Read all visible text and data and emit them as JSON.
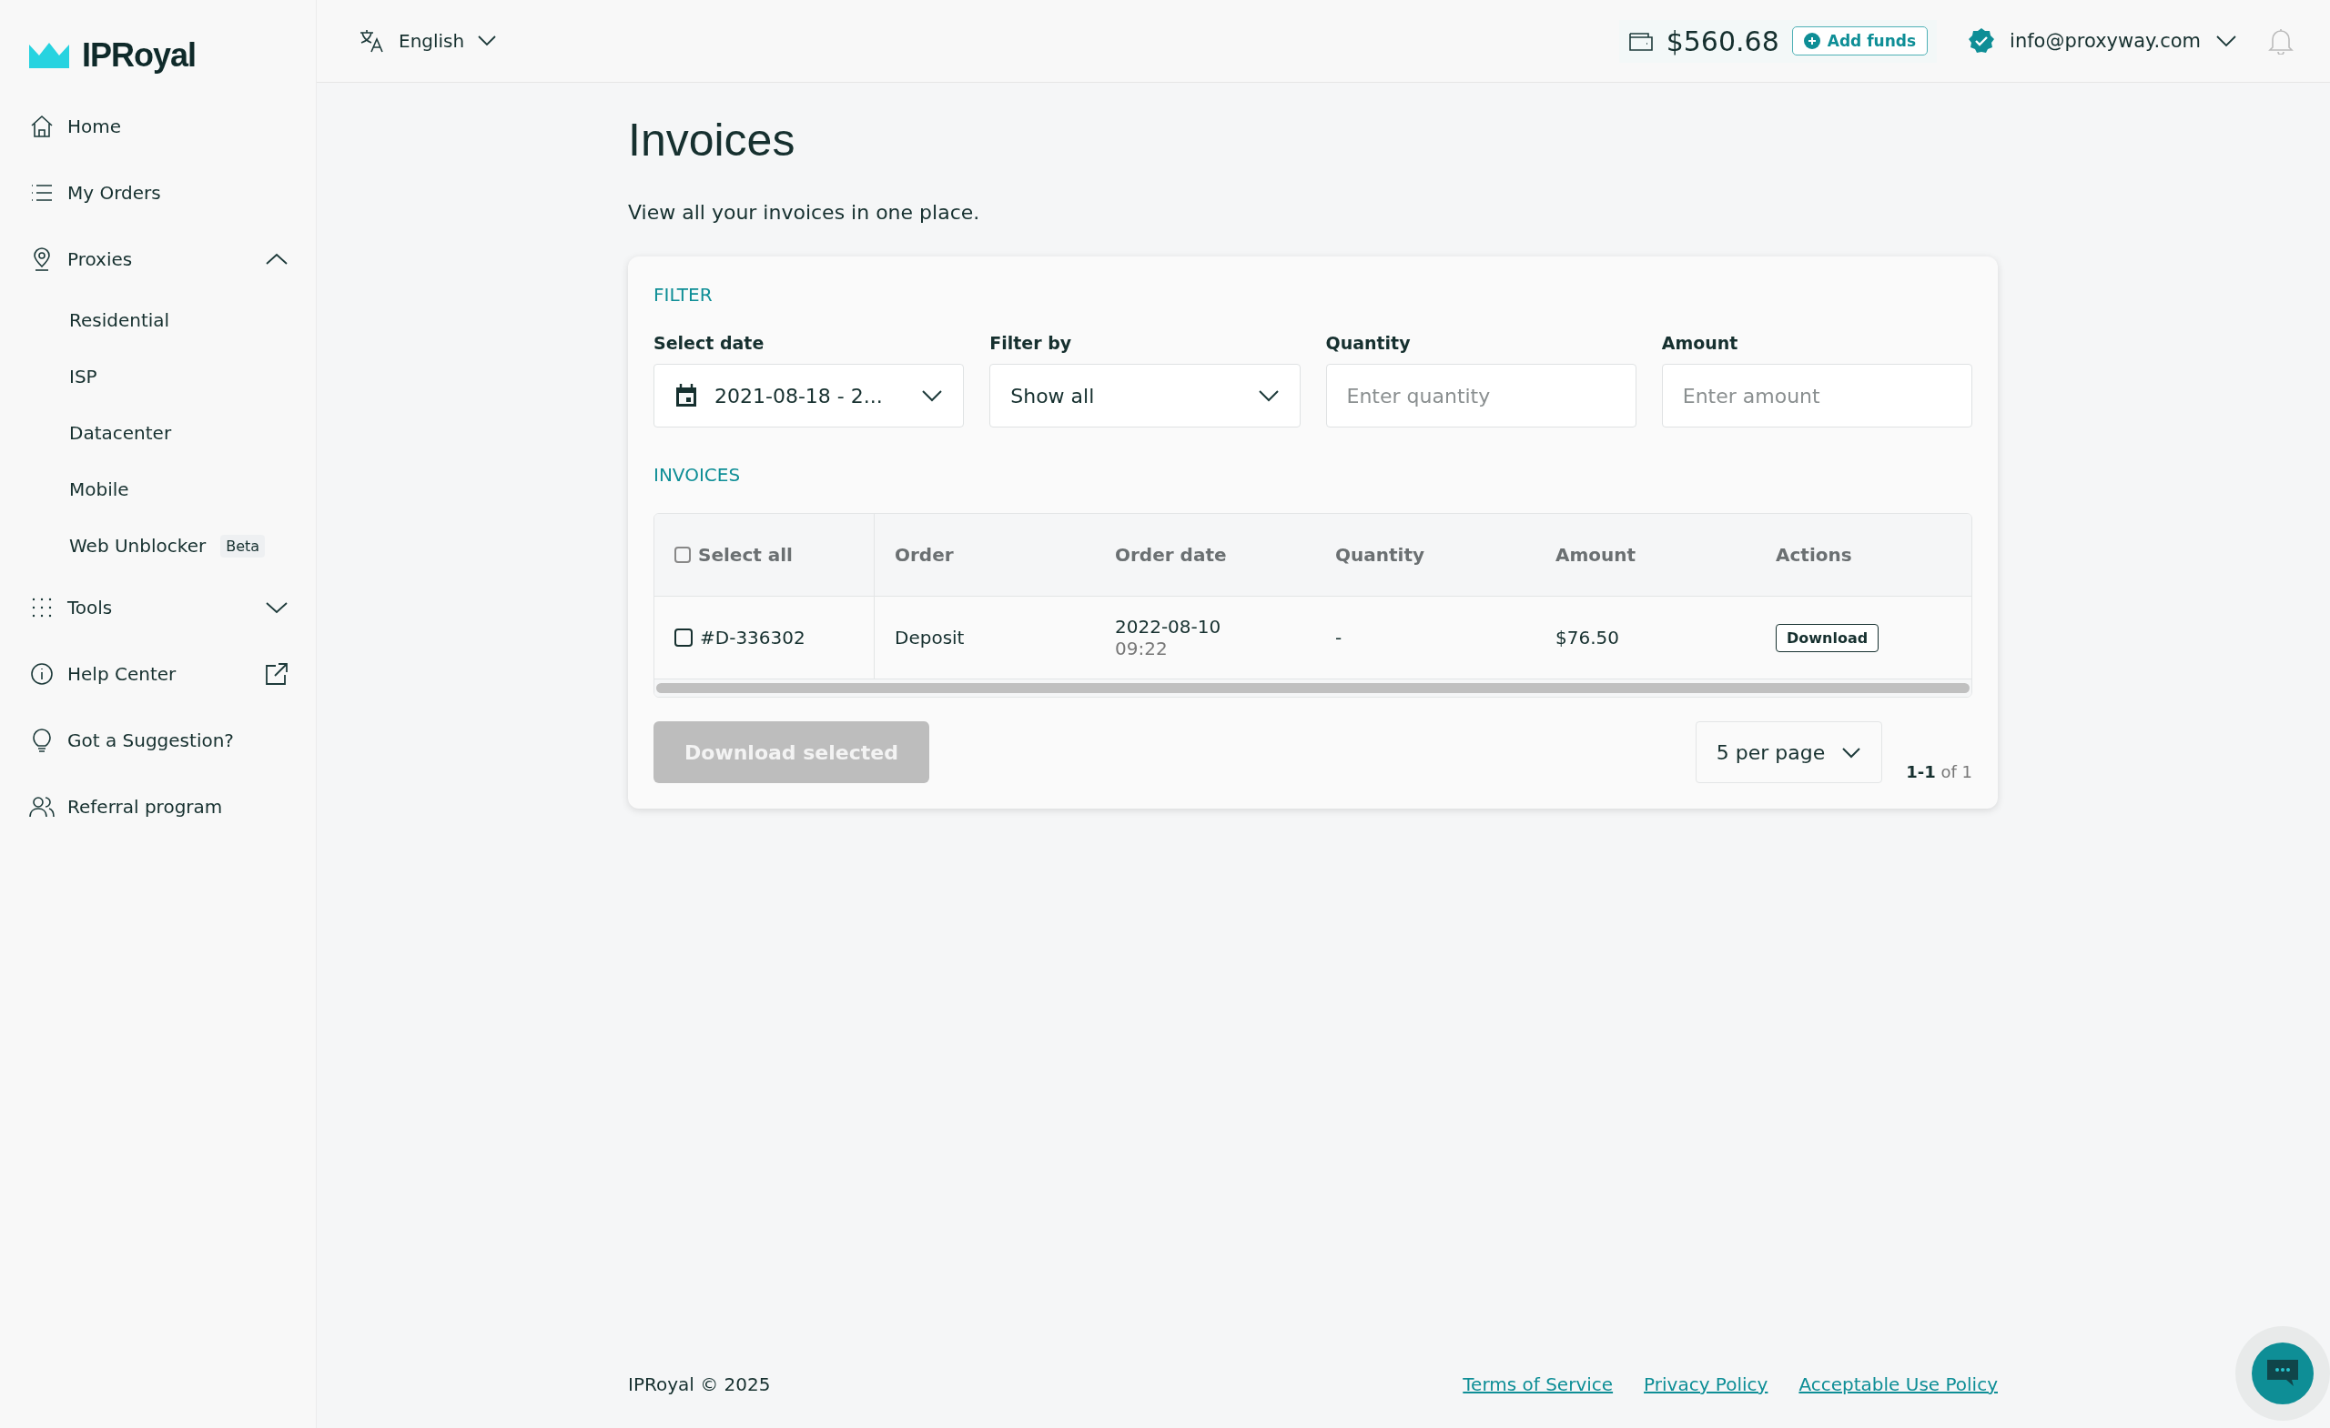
{
  "sidebar": {
    "logo": "IPRoyal",
    "items": [
      {
        "label": "Home"
      },
      {
        "label": "My Orders"
      },
      {
        "label": "Proxies",
        "expanded": true,
        "children": [
          {
            "label": "Residential"
          },
          {
            "label": "ISP"
          },
          {
            "label": "Datacenter"
          },
          {
            "label": "Mobile"
          },
          {
            "label": "Web Unblocker",
            "badge": "Beta"
          }
        ]
      },
      {
        "label": "Tools",
        "expanded": false
      },
      {
        "label": "Help Center",
        "external": true
      },
      {
        "label": "Got a Suggestion?"
      },
      {
        "label": "Referral program"
      }
    ]
  },
  "topbar": {
    "language": "English",
    "balance": "$560.68",
    "add_funds": "Add funds",
    "email": "info@proxyway.com"
  },
  "page": {
    "title": "Invoices",
    "subtitle": "View all your invoices in one place."
  },
  "filter": {
    "heading": "FILTER",
    "fields": [
      {
        "kind": "date",
        "label": "Select date",
        "value": "2021-08-18 - 2..."
      },
      {
        "kind": "select",
        "label": "Filter by",
        "value": "Show all"
      },
      {
        "kind": "input",
        "label": "Quantity",
        "placeholder": "Enter quantity"
      },
      {
        "kind": "input",
        "label": "Amount",
        "placeholder": "Enter amount"
      }
    ]
  },
  "invoices": {
    "heading": "INVOICES",
    "select_all": {
      "label": "Select all",
      "checked": false
    },
    "columns": [
      "Order",
      "Order date",
      "Quantity",
      "Amount",
      "Actions"
    ],
    "rows": [
      {
        "id": "#D-336302",
        "checked": false,
        "order": "Deposit",
        "date": "2022-08-10",
        "time": "09:22",
        "quantity": "-",
        "amount": "$76.50",
        "action": "Download"
      }
    ],
    "download_selected": {
      "label": "Download selected",
      "disabled": true
    },
    "per_page": "5 per page",
    "range": "1-1",
    "of": "of 1"
  },
  "footer": {
    "copyright": "IPRoyal © 2025",
    "links": [
      "Terms of Service",
      "Privacy Policy",
      "Acceptable Use Policy"
    ]
  }
}
